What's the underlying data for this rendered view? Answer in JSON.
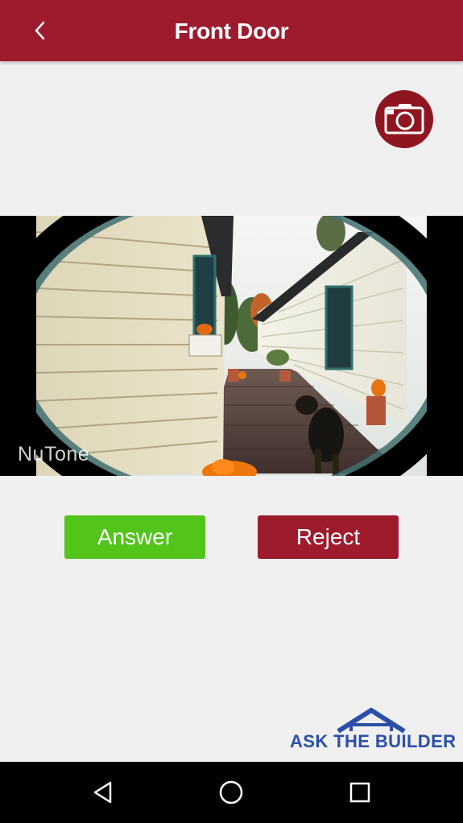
{
  "header": {
    "title": "Front Door",
    "back_icon": "chevron-left-icon",
    "background": "#9e1b2e"
  },
  "snapshot_button": {
    "icon": "camera-icon",
    "color": "#8f1620"
  },
  "video": {
    "watermark": "NuTone"
  },
  "actions": {
    "answer_label": "Answer",
    "answer_color": "#52c41a",
    "reject_label": "Reject",
    "reject_color": "#9e1b2e"
  },
  "brand": {
    "text": "ASK THE BUILDER",
    "icon": "house-roof-icon",
    "color": "#2b4fa8"
  },
  "nav_bar": {
    "back_icon": "triangle-back-icon",
    "home_icon": "circle-home-icon",
    "recents_icon": "square-recents-icon"
  }
}
